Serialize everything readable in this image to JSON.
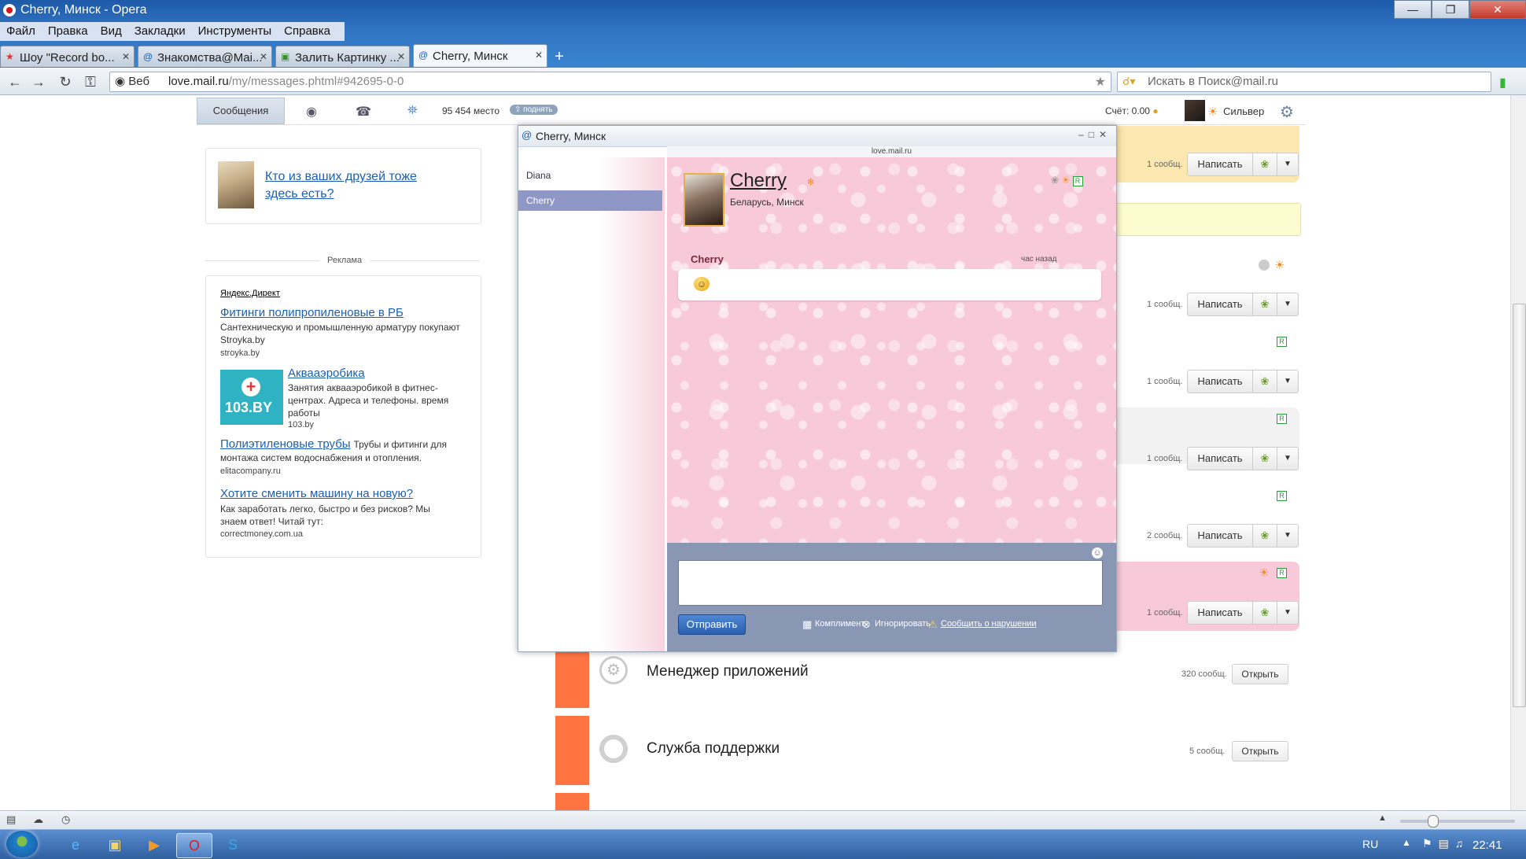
{
  "window": {
    "title": "Cherry, Минск - Opera"
  },
  "menu": [
    "Файл",
    "Правка",
    "Вид",
    "Закладки",
    "Инструменты",
    "Справка"
  ],
  "tabs": [
    {
      "label": "Шоу \"Record bo...",
      "active": false
    },
    {
      "label": "Знакомства@Mai...",
      "active": false
    },
    {
      "label": "Залить Картинку ...",
      "active": false
    },
    {
      "label": "Cherry, Минск",
      "active": true
    }
  ],
  "address": {
    "web_label": "Веб",
    "url_host": "love.mail.ru",
    "url_path": "/my/messages.phtml#942695-0-0",
    "search_placeholder": "Искать в Поиск@mail.ru"
  },
  "site_toolbar": {
    "messages_tab": "Сообщения",
    "rating": "95 454 место",
    "raise_label": "поднять",
    "account": "Счёт: 0.00",
    "status": "Сильвер"
  },
  "left": {
    "friends_link": "Кто из ваших друзей тоже здесь есть?",
    "ads_label": "Реклама",
    "yandex": "Яндекс.Директ",
    "ads": [
      {
        "title": "Фитинги полипропиленовые в РБ",
        "text": "Сантехническую и промышленную арматуру покупают Stroyka.by",
        "domain": "stroyka.by"
      },
      {
        "title": "Аквааэробика",
        "text": "Занятия аквааэробикой в фитнес-центрах. Адреса и телефоны. время работы",
        "domain": "103.by",
        "logo": "103.BY"
      },
      {
        "title": "Полиэтиленовые трубы",
        "text": "Трубы и фитинги для монтажа систем водоснабжения и отопления.",
        "domain": "elitacompany.ru"
      },
      {
        "title": "Хотите сменить машину на новую?",
        "text": "Как заработать легко, быстро и без рисков? Мы знаем ответ! Читай тут:",
        "domain": "correctmoney.com.ua"
      }
    ]
  },
  "contacts": {
    "write_label": "Написать",
    "rows": [
      {
        "count": "1 сообщ."
      },
      {
        "count": "1 сообщ."
      },
      {
        "count": "1 сообщ."
      },
      {
        "count": "1 сообщ."
      },
      {
        "count": "2 сообщ."
      },
      {
        "count": "1 сообщ."
      }
    ],
    "open_label": "Открыть",
    "system_rows": [
      {
        "title": "Менеджер приложений",
        "count": "320 сообщ."
      },
      {
        "title": "Служба поддержки",
        "count": "5 сообщ."
      }
    ]
  },
  "chat": {
    "title": "Cherry, Минск",
    "site": "love.mail.ru",
    "contacts": [
      {
        "name": "Diana",
        "active": false
      },
      {
        "name": "Cherry",
        "active": true
      }
    ],
    "profile": {
      "name": "Cherry",
      "location": "Беларусь, Минск"
    },
    "message": {
      "author": "Cherry",
      "time": "час назад"
    },
    "send_label": "Отправить",
    "compliment": "Комплимент",
    "ignore": "Игнорировать",
    "report": "Сообщить о нарушении"
  },
  "taskbar": {
    "lang": "RU",
    "clock": "22:41"
  },
  "colors": {
    "accent_orange": "#ff7441",
    "chat_pink": "#f7c9d9",
    "compose_blue": "#8996b4",
    "link_blue": "#1a5fb4"
  }
}
